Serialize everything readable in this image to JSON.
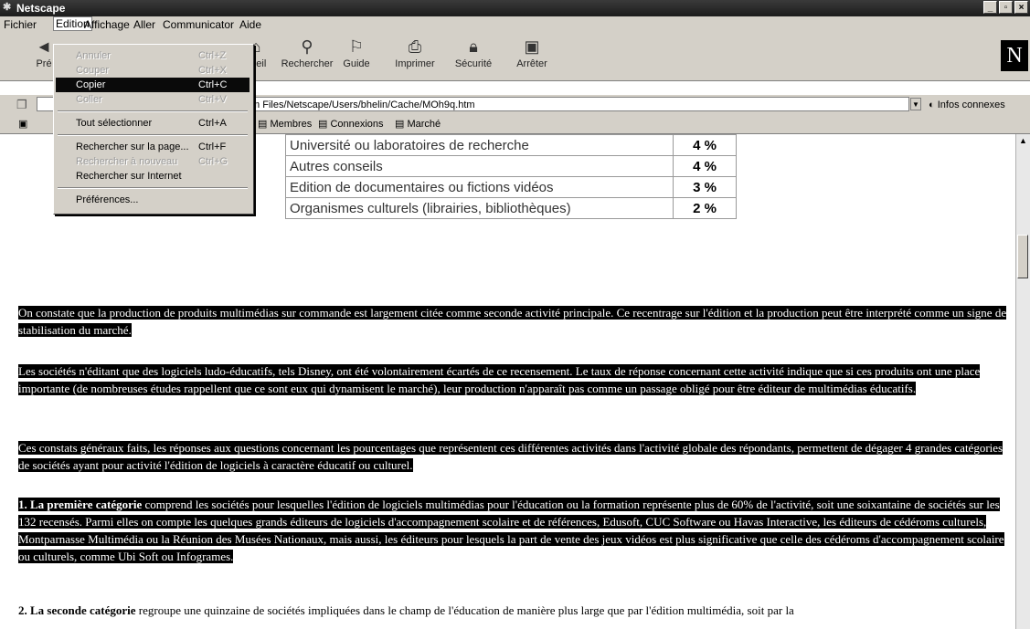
{
  "window": {
    "title": "Netscape"
  },
  "menubar": {
    "items": [
      "Fichier",
      "Edition",
      "Affichage",
      "Aller",
      "Communicator",
      "Aide"
    ],
    "active": "Edition"
  },
  "toolbar": {
    "buttons": [
      {
        "label": "Pré",
        "icon": "back-icon"
      },
      {
        "label": "cueil",
        "icon": "home-icon"
      },
      {
        "label": "Rechercher",
        "icon": "search-icon"
      },
      {
        "label": "Guide",
        "icon": "guide-icon"
      },
      {
        "label": "Imprimer",
        "icon": "print-icon"
      },
      {
        "label": "Sécurité",
        "icon": "lock-icon"
      },
      {
        "label": "Arrêter",
        "icon": "stop-icon"
      }
    ],
    "logo": "N"
  },
  "location": {
    "url": "m Files/Netscape/Users/bhelin/Cache/MOh9q.htm",
    "related": "Infos connexes"
  },
  "personal": {
    "items": [
      "Membres",
      "Connexions",
      "Marché"
    ]
  },
  "edit_menu": {
    "items": [
      {
        "label": "Annuler",
        "shortcut": "Ctrl+Z",
        "state": "disabled"
      },
      {
        "label": "Couper",
        "shortcut": "Ctrl+X",
        "state": "disabled"
      },
      {
        "label": "Copier",
        "shortcut": "Ctrl+C",
        "state": "selected"
      },
      {
        "label": "Coller",
        "shortcut": "Ctrl+V",
        "state": "disabled"
      },
      {
        "label": "Tout sélectionner",
        "shortcut": "Ctrl+A",
        "state": "normal"
      },
      {
        "label": "Rechercher sur la page...",
        "shortcut": "Ctrl+F",
        "state": "normal"
      },
      {
        "label": "Rechercher à nouveau",
        "shortcut": "Ctrl+G",
        "state": "disabled"
      },
      {
        "label": "Rechercher sur Internet",
        "shortcut": "",
        "state": "normal"
      },
      {
        "label": "Préférences...",
        "shortcut": "",
        "state": "normal"
      }
    ]
  },
  "table": {
    "rows": [
      {
        "label": "Université ou laboratoires de recherche",
        "pct": "4 %"
      },
      {
        "label": "Autres conseils",
        "pct": "4 %"
      },
      {
        "label": "Edition de documentaires ou fictions vidéos",
        "pct": "3 %"
      },
      {
        "label": "Organismes culturels (librairies, bibliothèques)",
        "pct": "2 %"
      }
    ]
  },
  "paragraphs": {
    "p1": "On constate que la production de produits multimédias sur commande est largement citée comme seconde activité principale. Ce recentrage sur l'édition et la production peut être interprété comme un signe de stabilisation du marché.",
    "p2": "Les sociétés n'éditant que des logiciels ludo-éducatifs, tels Disney, ont été volontairement écartés de ce recensement. Le taux de réponse concernant cette activité indique que si ces produits ont une place importante (de nombreuses études rappellent que ce sont eux qui dynamisent le marché), leur production n'apparaît pas comme un passage obligé pour être éditeur de multimédias éducatifs.",
    "p3": "Ces constats généraux faits, les réponses aux questions concernant les pourcentages que représentent ces différentes activités dans l'activité globale des répondants, permettent de dégager 4 grandes catégories de sociétés ayant pour activité l'édition de logiciels à caractère éducatif ou culturel.",
    "p4_bold": "1. La première catégorie",
    "p4": " comprend les sociétés pour lesquelles l'édition de logiciels multimédias pour l'éducation ou la formation représente plus de 60% de l'activité, soit une soixantaine de sociétés sur les 132 recensés. Parmi elles on compte les quelques grands éditeurs de logiciels d'accompagnement scolaire et de références, Edusoft, CUC Software ou Havas Interactive, les éditeurs de cédéroms culturels, Montparnasse Multimédia ou la Réunion des Musées Nationaux, mais aussi, les éditeurs pour lesquels la part de vente des jeux vidéos est plus significative que celle des cédéroms d'accompagnement scolaire ou culturels, comme Ubi Soft ou Infogrames.",
    "p5_bold": "2. La seconde catégorie",
    "p5": " regroupe une quinzaine de sociétés impliquées dans le champ de l'éducation de manière plus large que par l'édition multimédia, soit par la"
  }
}
